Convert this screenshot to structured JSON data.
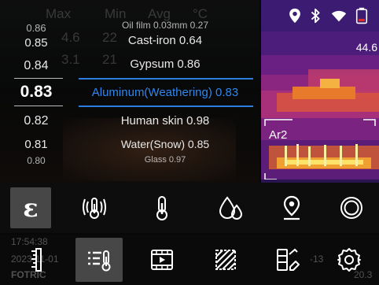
{
  "header_faint": {
    "col1": "Max",
    "col2": "Min",
    "col3": "Avg",
    "col4": "°C",
    "row1_a": "4.6",
    "row1_b": "22",
    "row2_a": "3.1",
    "row2_b": "21"
  },
  "picker": {
    "values": [
      "0.86",
      "0.85",
      "0.84",
      "0.83",
      "0.82",
      "0.81",
      "0.80"
    ],
    "materials": [
      "Oil film 0.03mm 0.27",
      "Cast-iron 0.64",
      "Gypsum 0.86",
      "Aluminum(Weathering) 0.83",
      "Human skin 0.98",
      "Water(Snow) 0.85",
      "Glass 0.97"
    ],
    "selected_index": 3,
    "selected_value": "0.83",
    "selected_material": "Aluminum(Weathering) 0.83",
    "accent_color": "#2b7de0"
  },
  "thermal": {
    "temperature": "44.6",
    "area_label": "Ar2"
  },
  "status_bar": {
    "icons": [
      "location-pin-icon",
      "bluetooth-icon",
      "wifi-icon",
      "battery-icon"
    ],
    "battery_color": "#e02a2a"
  },
  "toolbar_top": {
    "items": [
      {
        "name": "emissivity",
        "label": "ε",
        "active": true
      },
      {
        "name": "reflected-temperature",
        "icon": "thermometer-waves-icon"
      },
      {
        "name": "ambient-temperature",
        "icon": "thermometer-icon"
      },
      {
        "name": "humidity",
        "icon": "water-drops-icon"
      },
      {
        "name": "distance",
        "icon": "location-pin-icon"
      },
      {
        "name": "lens-setting",
        "icon": "ring-icon"
      }
    ]
  },
  "toolbar_bottom": {
    "items": [
      {
        "name": "ruler",
        "icon": "ruler-icon"
      },
      {
        "name": "temperature-list",
        "icon": "list-thermometer-icon",
        "active": true
      },
      {
        "name": "video",
        "icon": "film-play-icon"
      },
      {
        "name": "image-area",
        "icon": "hatched-square-icon"
      },
      {
        "name": "palette-edit",
        "icon": "palette-edit-icon"
      },
      {
        "name": "settings",
        "icon": "gear-icon"
      }
    ],
    "faint_time": "17:54:38",
    "faint_date": "2023-11-01",
    "faint_brand": "FOTRIC",
    "faint_right": "-13",
    "faint_right2": "20.3"
  }
}
